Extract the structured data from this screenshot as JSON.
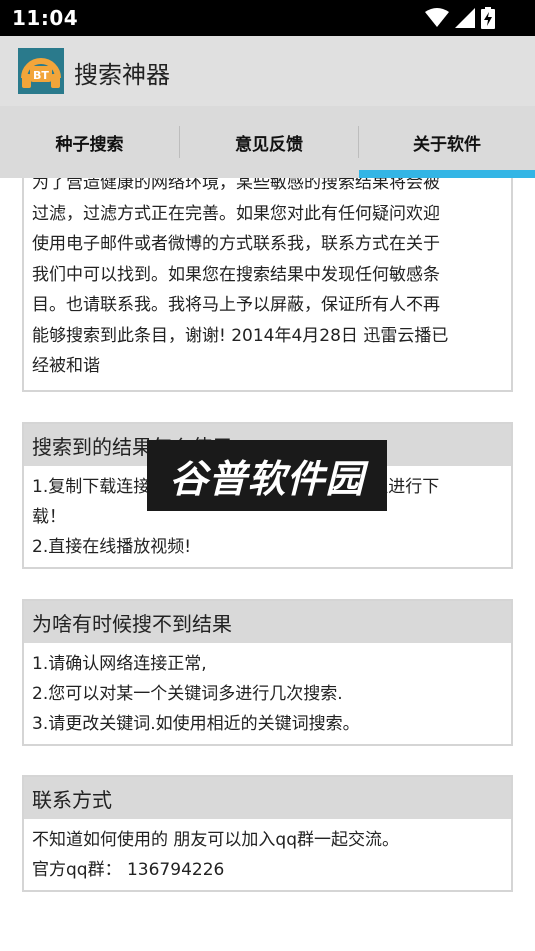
{
  "status_bar": {
    "time": "11:04",
    "icons": [
      "wifi-icon",
      "signal-icon",
      "battery-icon"
    ]
  },
  "app_bar": {
    "logo_text": "BT",
    "title": "搜索神器"
  },
  "tabs": [
    {
      "label": "种子搜索",
      "selected": false
    },
    {
      "label": "意见反馈",
      "selected": false
    },
    {
      "label": "关于软件",
      "selected": true
    }
  ],
  "accent_color": "#33b5e5",
  "cards": {
    "about": {
      "lines": [
        "为了营造健康的网络环境，某些敏感的搜索结果将会被",
        "过滤，过滤方式正在完善。如果您对此有任何疑问欢迎",
        "使用电子邮件或者微博的方式联系我，联系方式在关于",
        "我们中可以找到。如果您在搜索结果中发现任何敏感条",
        "目。也请联系我。我将马上予以屏蔽，保证所有人不再",
        "能够搜索到此条目，谢谢! 2014年4月28日 迅雷云播已",
        "经被和谐"
      ]
    },
    "usage": {
      "title": "搜索到的结果怎么使用",
      "lines": [
        "1.复制下载连接到迅雷或者其他下载软件即可以进行下",
        "载！",
        "2.直接在线播放视频!"
      ]
    },
    "no_results": {
      "title": "为啥有时候搜不到结果",
      "lines": [
        "1.请确认网络连接正常,",
        "2.您可以对某一个关键词多进行几次搜索.",
        "3.请更改关键词.如使用相近的关键词搜索。"
      ]
    },
    "contact": {
      "title": "联系方式",
      "lines": [
        "不知道如何使用的 朋友可以加入qq群一起交流。",
        "官方qq群：  136794226"
      ]
    }
  },
  "watermark": "谷普软件园"
}
